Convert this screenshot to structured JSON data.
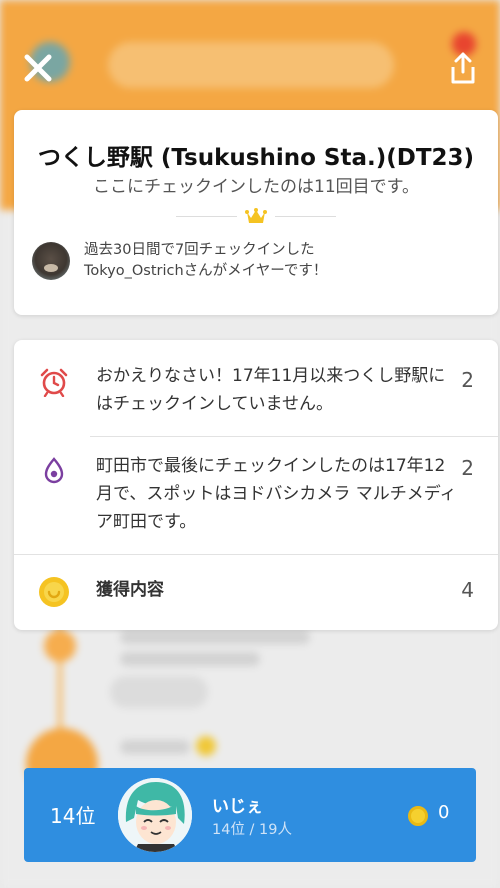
{
  "venue": {
    "title": "つくし野駅 (Tsukushino Sta.)(DT23)",
    "checkin_count_text": "ここにチェックインしたのは11回目です。",
    "mayor_line1": "過去30日間で7回チェックインした",
    "mayor_line2": "Tokyo_Ostrichさんがメイヤーです！"
  },
  "stats": [
    {
      "icon": "alarm-clock-icon",
      "text": "おかえりなさい！17年11月以来つくし野駅にはチェックインしていません。",
      "count": "2"
    },
    {
      "icon": "location-pin-icon",
      "text": "町田市で最後にチェックインしたのは17年12月で、スポットはヨドバシカメラ マルチメディア町田です。",
      "count": "2"
    },
    {
      "icon": "coin-icon",
      "text": "獲得内容",
      "count": "4"
    }
  ],
  "rank": {
    "position": "14位",
    "name": "いじぇ",
    "sub": "14位 / 19人",
    "coins": "0"
  },
  "colors": {
    "accent_orange": "#f4a743",
    "rank_blue": "#2f8ee0",
    "alarm_red": "#e04a4a",
    "pin_purple": "#7b3fa0",
    "coin_yellow": "#f5c322"
  }
}
